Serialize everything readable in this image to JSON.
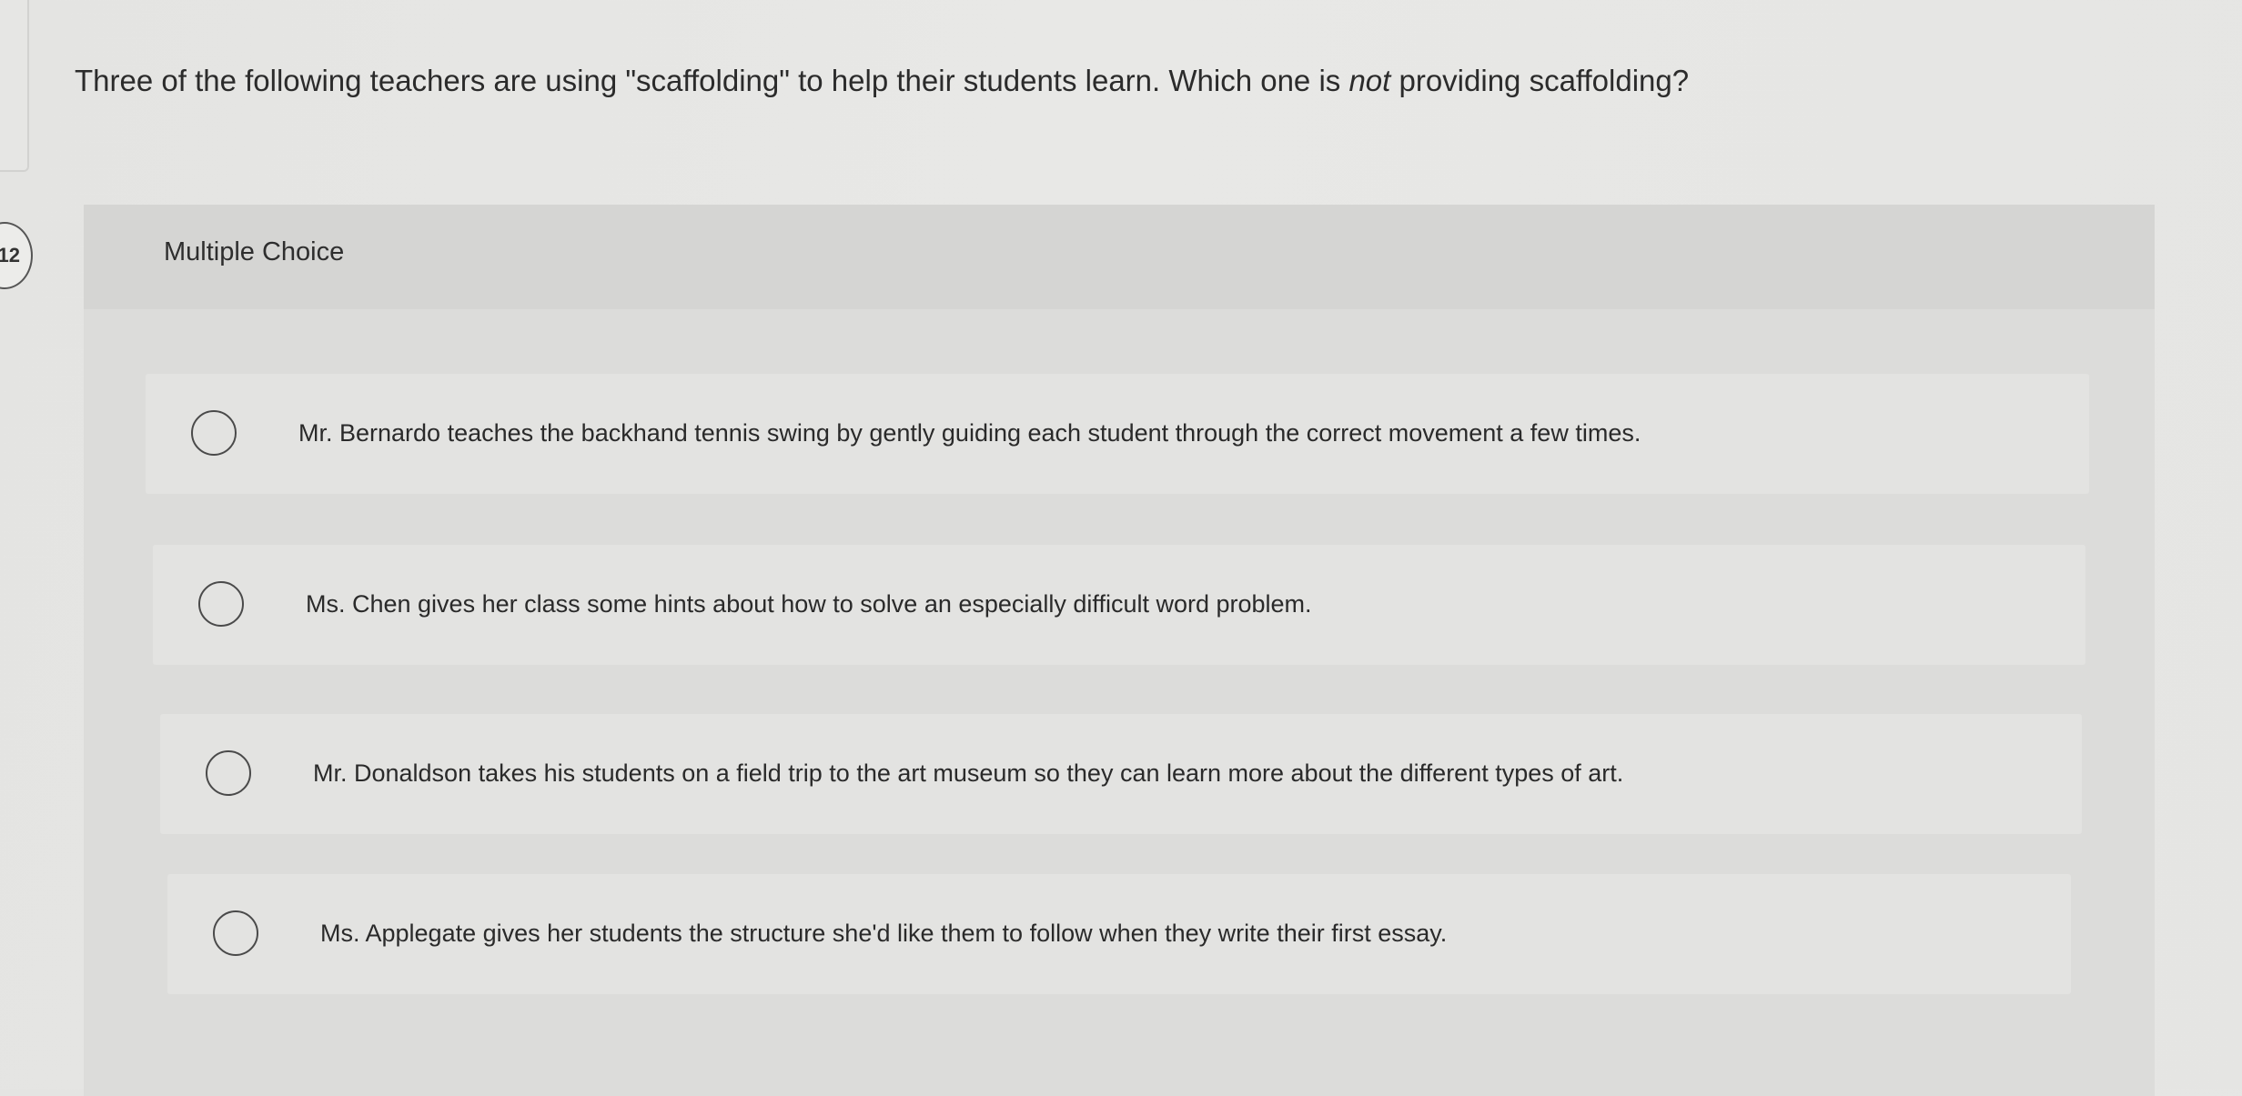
{
  "question": {
    "number": "12",
    "prompt_before": "Three of the following teachers are using \"scaffolding\" to help their students learn. Which one is ",
    "prompt_emphasis": "not",
    "prompt_after": " providing scaffolding?"
  },
  "multiple_choice": {
    "label": "Multiple Choice",
    "options": [
      "Mr. Bernardo teaches the backhand tennis swing by gently guiding each student through the correct movement a few times.",
      "Ms. Chen gives her class some hints about how to solve an especially difficult word problem.",
      "Mr. Donaldson takes his students on a field trip to the art museum so they can learn more about the different types of art.",
      "Ms. Applegate gives her students the structure she'd like them to follow when they write their first essay."
    ]
  }
}
